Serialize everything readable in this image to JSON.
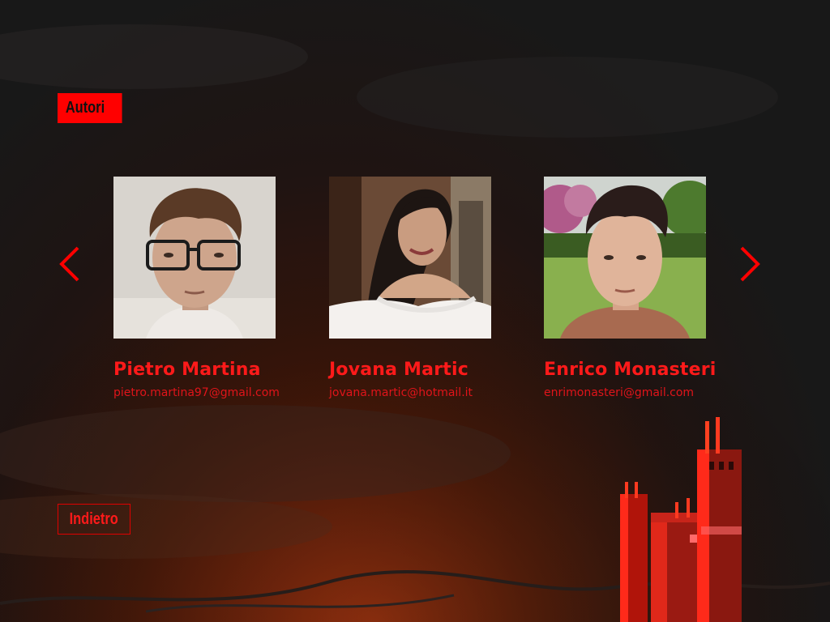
{
  "header": {
    "title": "Autori"
  },
  "nav": {
    "prev_icon": "chevron-left-icon",
    "next_icon": "chevron-right-icon"
  },
  "authors": [
    {
      "name": "Pietro Martina",
      "email": "pietro.martina97@gmail.com"
    },
    {
      "name": "Jovana Martic",
      "email": "jovana.martic@hotmail.it"
    },
    {
      "name": "Enrico Monasteri",
      "email": "enrimonasteri@gmail.com"
    }
  ],
  "footer": {
    "back_label": "Indietro"
  },
  "colors": {
    "accent": "#ff0000",
    "background": "#1a1717"
  }
}
